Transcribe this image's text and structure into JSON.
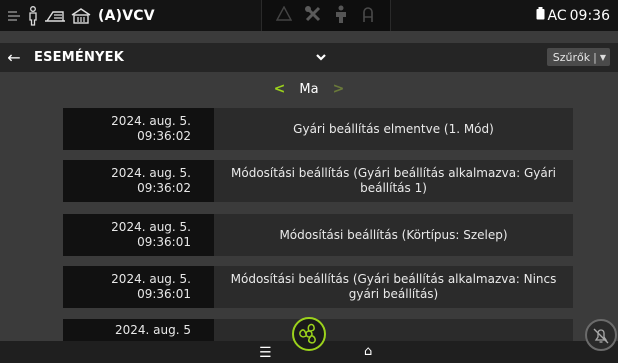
{
  "status_bar": {
    "mode": "(A)VCV",
    "battery_label": "AC",
    "time": "09:36",
    "left_icons": [
      "ventilator-icon",
      "patient-icon",
      "humidifier-icon",
      "building-icon"
    ],
    "center_icons": [
      "alarm-triangle-icon",
      "tools-icon",
      "person-icon",
      "hose-icon"
    ]
  },
  "header": {
    "title": "ESEMÉNYEK",
    "filters_label": "Szűrők",
    "filters_separator": "|"
  },
  "day_nav": {
    "label": "Ma",
    "prev": "<",
    "next": ">"
  },
  "events": [
    {
      "date": "2024. aug. 5.",
      "time": "09:36:02",
      "description": "Gyári beállítás elmentve (1. Mód)"
    },
    {
      "date": "2024. aug. 5.",
      "time": "09:36:02",
      "description": "Módosítási beállítás (Gyári beállítás alkalmazva: Gyári beállítás 1)"
    },
    {
      "date": "2024. aug. 5.",
      "time": "09:36:01",
      "description": "Módosítási beállítás (Körtípus: Szelep)"
    },
    {
      "date": "2024. aug. 5.",
      "time": "09:36:01",
      "description": "Módosítási beállítás (Gyári beállítás alkalmazva: Nincs gyári beállítás)"
    },
    {
      "date": "2024. aug. 5",
      "time": "",
      "description": ""
    }
  ],
  "colors": {
    "accent": "#9bd21c",
    "background": "#3b3b3b",
    "row_date_bg": "#111111",
    "row_desc_bg": "#2b2b2b"
  }
}
